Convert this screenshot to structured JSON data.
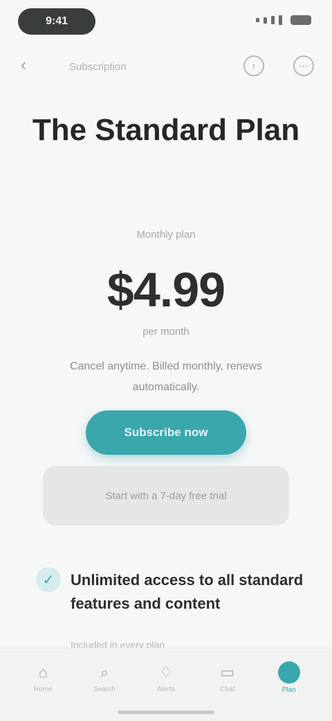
{
  "status_bar": {
    "time": "9:41",
    "colors": {
      "pill": "#3a3d3d",
      "icons": "#6a6d6d"
    }
  },
  "nav": {
    "back_icon": "chevron-left-icon",
    "breadcrumb": "Subscription",
    "share_icon": "share-icon",
    "more_icon": "more-icon"
  },
  "page": {
    "title": "The Standard Plan",
    "plan_label": "Monthly plan",
    "price": "$4.99",
    "price_period": "per month",
    "price_note": "Cancel anytime. Billed monthly, renews automatically.",
    "subscribe_label": "Subscribe now",
    "trial_text": "Start with a 7-day free trial",
    "accent_color": "#3aa7ad"
  },
  "feature": {
    "check_icon": "check-icon",
    "title": "Unlimited access to all standard features and content",
    "subtitle": "Included in every plan"
  },
  "tabs": [
    {
      "icon": "home-icon",
      "glyph": "⌂",
      "label": "Home"
    },
    {
      "icon": "search-icon",
      "glyph": "⌕",
      "label": "Search"
    },
    {
      "icon": "bell-icon",
      "glyph": "♢",
      "label": "Alerts"
    },
    {
      "icon": "chat-icon",
      "glyph": "▭",
      "label": "Chat"
    },
    {
      "icon": "profile-icon",
      "glyph": "",
      "label": "Plan"
    }
  ]
}
